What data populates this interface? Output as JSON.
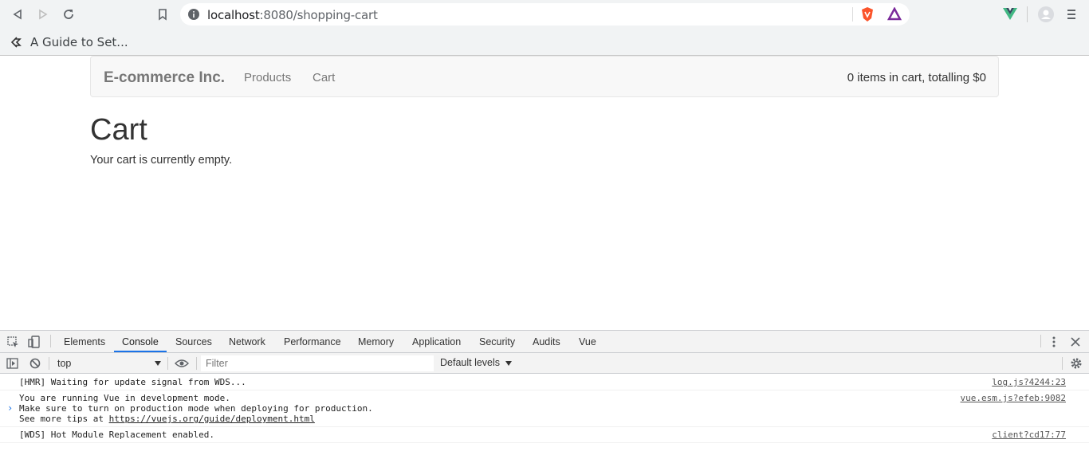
{
  "browser": {
    "url_host": "localhost",
    "url_path": ":8080/shopping-cart",
    "bookmark": "A Guide to Set..."
  },
  "app": {
    "brand": "E-commerce Inc.",
    "nav": [
      "Products",
      "Cart"
    ],
    "cart_summary": "0 items in cart, totalling $0",
    "title": "Cart",
    "message": "Your cart is currently empty."
  },
  "devtools": {
    "tabs": [
      "Elements",
      "Console",
      "Sources",
      "Network",
      "Performance",
      "Memory",
      "Application",
      "Security",
      "Audits",
      "Vue"
    ],
    "active_tab": "Console",
    "context": "top",
    "filter_placeholder": "Filter",
    "levels": "Default levels",
    "messages": [
      {
        "lines": [
          "[HMR] Waiting for update signal from WDS..."
        ],
        "source": "log.js?4244:23"
      },
      {
        "lines": [
          "You are running Vue in development mode.",
          "Make sure to turn on production mode when deploying for production.",
          "See more tips at "
        ],
        "link": "https://vuejs.org/guide/deployment.html",
        "source": "vue.esm.js?efeb:9082"
      },
      {
        "lines": [
          "[WDS] Hot Module Replacement enabled."
        ],
        "source": "client?cd17:77"
      }
    ]
  }
}
